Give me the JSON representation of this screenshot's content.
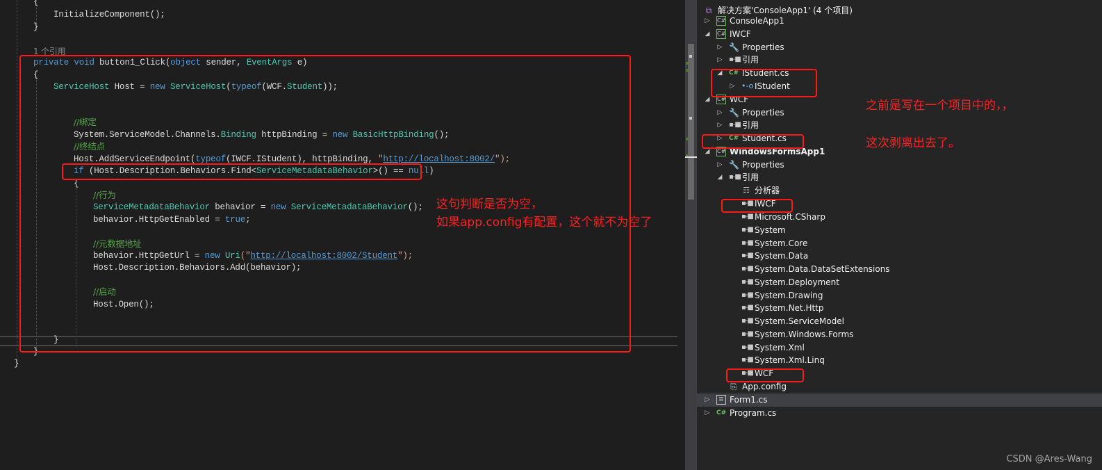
{
  "editor": {
    "lines": {
      "brace_open_ctor": "{",
      "init_call": "InitializeComponent();",
      "brace_close_ctor": "}",
      "ref_count": "1 个引用",
      "sig_private": "private",
      "sig_void": "void",
      "sig_name": "button1_Click(",
      "sig_object": "object",
      "sig_sender": " sender, ",
      "sig_eventargs": "EventArgs",
      "sig_e": " e)",
      "brace_open_method": "{",
      "host_type": "ServiceHost",
      "host_var": " Host = ",
      "host_new": "new",
      "host_ctor": "ServiceHost",
      "host_paren": "(",
      "host_typeof": "typeof",
      "host_arg": "(WCF.",
      "host_student": "Student",
      "host_end": "));",
      "comment_binding": "//绑定",
      "binding_ns": "System.ServiceModel.Channels.",
      "binding_type": "Binding",
      "binding_var": " httpBinding = ",
      "binding_new": "new",
      "binding_ctor": "BasicHttpBinding",
      "binding_end": "();",
      "comment_endpoint": "//终结点",
      "endpoint_call": "Host.AddServiceEndpoint(",
      "endpoint_typeof": "typeof",
      "endpoint_arg": "(IWCF.IStudent), httpBinding, ",
      "endpoint_q1": "\"",
      "endpoint_url": "http://localhost:8002/",
      "endpoint_end": "\");",
      "if_kw": "if",
      "if_expr": " (Host.Description.Behaviors.Find<",
      "if_type": "ServiceMetadataBehavior",
      "if_cmp": ">() == ",
      "if_null": "null",
      "if_end": ")",
      "brace_open_if": "{",
      "comment_behavior": "//行为",
      "behavior_type": "ServiceMetadataBehavior",
      "behavior_var": " behavior = ",
      "behavior_new": "new",
      "behavior_ctor": "ServiceMetadataBehavior",
      "behavior_end": "();",
      "enabled_lhs": "behavior.HttpGetEnabled = ",
      "enabled_true": "true",
      "enabled_end": ";",
      "comment_metadata": "//元数据地址",
      "geturl_lhs": "behavior.HttpGetUrl = ",
      "geturl_new": "new",
      "geturl_uri": "Uri",
      "geturl_q1": "(\"",
      "geturl_url": "http://localhost:8002/Student",
      "geturl_end": "\");",
      "add_behavior": "Host.Description.Behaviors.Add(behavior);",
      "comment_start": "//启动",
      "open_call": "Host.Open();",
      "brace_close_if": "}",
      "brace_close_method": "}",
      "brace_close_class": "}"
    },
    "annotation": {
      "line1": "这句判断是否为空，",
      "line2": "如果app.config有配置，这个就不为空了"
    }
  },
  "solution_explorer": {
    "solution_label": "解决方案'ConsoleApp1' (4 个项目)",
    "items": [
      {
        "label": "ConsoleApp1",
        "icon": "csharp-project-icon",
        "expanded": false
      },
      {
        "label": "IWCF",
        "icon": "csharp-project-icon",
        "expanded": true
      },
      {
        "label": "Properties",
        "icon": "wrench-icon",
        "expanded": false
      },
      {
        "label": "引用",
        "icon": "reference-icon",
        "expanded": false
      },
      {
        "label": "IStudent.cs",
        "icon": "csharp-file-icon",
        "expanded": true
      },
      {
        "label": "IStudent",
        "icon": "interface-icon",
        "expanded": false
      },
      {
        "label": "WCF",
        "icon": "csharp-project-icon",
        "expanded": true
      },
      {
        "label": "Properties",
        "icon": "wrench-icon",
        "expanded": false
      },
      {
        "label": "引用",
        "icon": "reference-icon",
        "expanded": false
      },
      {
        "label": "Student.cs",
        "icon": "csharp-file-icon",
        "expanded": false
      },
      {
        "label": "WindowsFormsApp1",
        "icon": "csharp-project-icon",
        "expanded": true
      },
      {
        "label": "Properties",
        "icon": "wrench-icon",
        "expanded": false
      },
      {
        "label": "引用",
        "icon": "reference-icon",
        "expanded": true
      },
      {
        "label": "分析器",
        "icon": "analyzer-icon"
      },
      {
        "label": "IWCF",
        "icon": "reference-icon"
      },
      {
        "label": "Microsoft.CSharp",
        "icon": "reference-icon"
      },
      {
        "label": "System",
        "icon": "reference-icon"
      },
      {
        "label": "System.Core",
        "icon": "reference-icon"
      },
      {
        "label": "System.Data",
        "icon": "reference-icon"
      },
      {
        "label": "System.Data.DataSetExtensions",
        "icon": "reference-icon"
      },
      {
        "label": "System.Deployment",
        "icon": "reference-icon"
      },
      {
        "label": "System.Drawing",
        "icon": "reference-icon"
      },
      {
        "label": "System.Net.Http",
        "icon": "reference-icon"
      },
      {
        "label": "System.ServiceModel",
        "icon": "reference-icon"
      },
      {
        "label": "System.Windows.Forms",
        "icon": "reference-icon"
      },
      {
        "label": "System.Xml",
        "icon": "reference-icon"
      },
      {
        "label": "System.Xml.Linq",
        "icon": "reference-icon"
      },
      {
        "label": "WCF",
        "icon": "reference-icon"
      },
      {
        "label": "App.config",
        "icon": "config-icon"
      },
      {
        "label": "Form1.cs",
        "icon": "form-icon",
        "expanded": false,
        "selected": true
      },
      {
        "label": "Program.cs",
        "icon": "csharp-file-icon",
        "expanded": false
      }
    ],
    "annotation": {
      "line1": "之前是写在一个项目中的，，",
      "line2": "这次剥离出去了。"
    }
  },
  "watermark": "CSDN @Ares-Wang",
  "colors": {
    "keyword": "#569cd6",
    "type": "#4ec9b0",
    "comment": "#57a64a",
    "annotation_red": "#ff1a1a",
    "csharp_green": "#6dbd5f"
  }
}
